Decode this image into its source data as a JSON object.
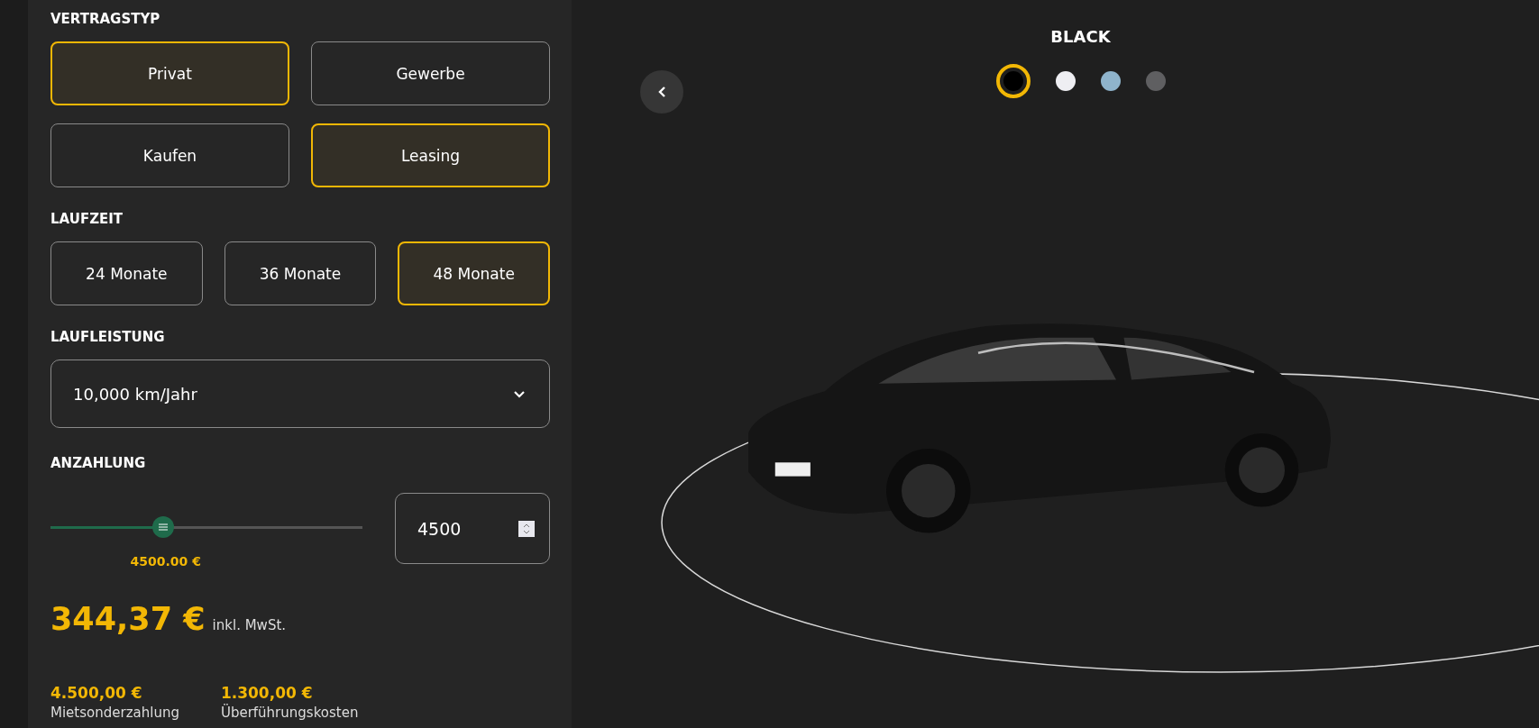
{
  "config": {
    "contract_type": {
      "label": "VERTRAGSTYP",
      "options": [
        {
          "label": "Privat",
          "selected": true
        },
        {
          "label": "Gewerbe",
          "selected": false
        },
        {
          "label": "Kaufen",
          "selected": false
        },
        {
          "label": "Leasing",
          "selected": true
        }
      ]
    },
    "term": {
      "label": "LAUFZEIT",
      "options": [
        {
          "label": "24 Monate",
          "selected": false
        },
        {
          "label": "36 Monate",
          "selected": false
        },
        {
          "label": "48 Monate",
          "selected": true
        }
      ]
    },
    "mileage": {
      "label": "LAUFLEISTUNG",
      "value": "10,000 km/Jahr"
    },
    "down_payment": {
      "label": "ANZAHLUNG",
      "level": 0.36,
      "reading": "4500.00 €",
      "input_value": "4500"
    },
    "price": {
      "amount": "344,37 €",
      "note": "inkl. MwSt."
    },
    "costs": [
      {
        "amount": "4.500,00 €",
        "label": "Mietsonderzahlung"
      },
      {
        "amount": "1.300,00 €",
        "label": "Überführungskosten"
      }
    ]
  },
  "viewer": {
    "color_name": "BLACK",
    "swatches": [
      {
        "color": "#000000",
        "selected": true
      },
      {
        "color": "#eeeef2",
        "selected": false
      },
      {
        "color": "#8fb4cc",
        "selected": false
      },
      {
        "color": "#5f5f61",
        "selected": false
      }
    ]
  }
}
